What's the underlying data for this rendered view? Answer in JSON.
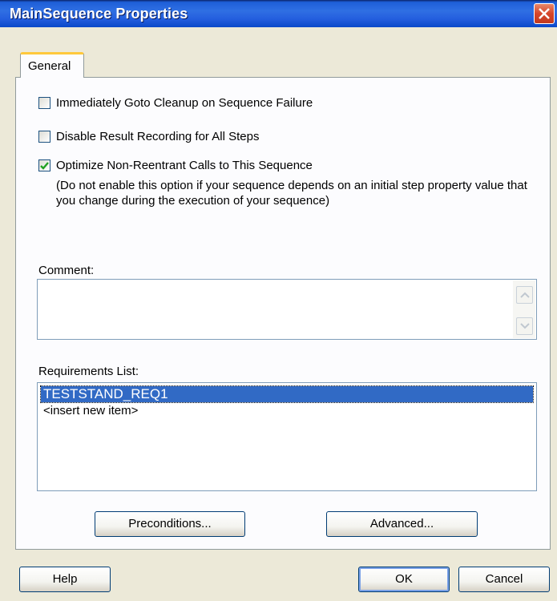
{
  "window": {
    "title": "MainSequence Properties"
  },
  "tabs": [
    {
      "label": "General",
      "active": true
    }
  ],
  "options": [
    {
      "label": "Immediately Goto Cleanup on Sequence Failure",
      "checked": false
    },
    {
      "label": "Disable Result Recording for All Steps",
      "checked": false
    },
    {
      "label": "Optimize Non-Reentrant Calls to This Sequence",
      "checked": true
    }
  ],
  "optimize_note": "(Do not enable this option if your sequence depends on an initial step property value that you change during the execution of your sequence)",
  "comment": {
    "label": "Comment:",
    "value": ""
  },
  "requirements": {
    "label": "Requirements List:",
    "items": [
      {
        "text": "TESTSTAND_REQ1",
        "selected": true
      },
      {
        "text": "<insert new item>",
        "selected": false
      }
    ]
  },
  "buttons": {
    "preconditions": "Preconditions...",
    "advanced": "Advanced...",
    "help": "Help",
    "ok": "OK",
    "cancel": "Cancel"
  },
  "colors": {
    "titlebar": "#245ede",
    "selection": "#316ac5",
    "dialog_bg": "#ece9d8"
  }
}
